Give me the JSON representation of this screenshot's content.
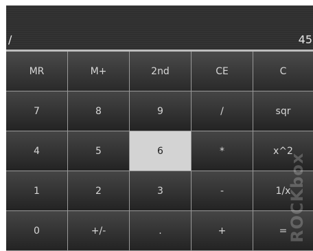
{
  "display": {
    "operator": "/",
    "value": "45"
  },
  "keys": {
    "row1": [
      "MR",
      "M+",
      "2nd",
      "CE",
      "C"
    ],
    "row2": [
      "7",
      "8",
      "9",
      "/",
      "sqr"
    ],
    "row3": [
      "4",
      "5",
      "6",
      "*",
      "x^2"
    ],
    "row4": [
      "1",
      "2",
      "3",
      "-",
      "1/x"
    ],
    "row5": [
      "0",
      "+/-",
      ".",
      "+",
      "="
    ]
  },
  "brand": {
    "watermark": "ROCKbox"
  },
  "colors": {
    "key_background": "#2b2b2b",
    "key_text": "#d6d6d6",
    "grid_lines": "#9a9a9a",
    "active_key": "#d3d3d3"
  }
}
